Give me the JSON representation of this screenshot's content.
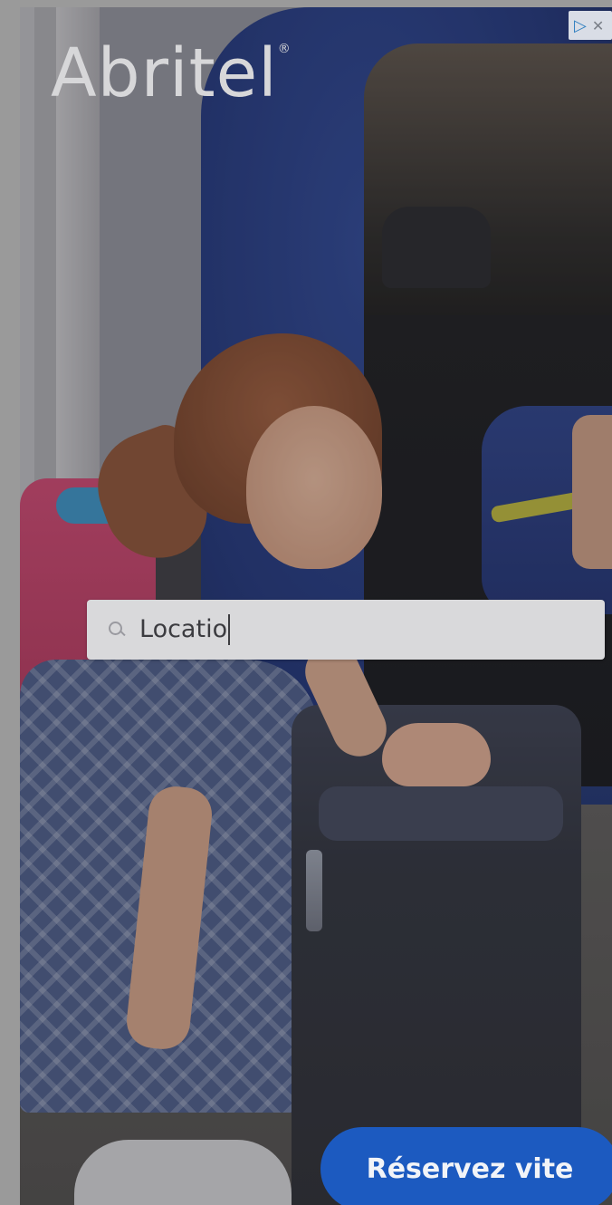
{
  "ad": {
    "brand": "Abritel",
    "brand_mark": "®",
    "search": {
      "typed_text": "Locatio"
    },
    "cta_label": "Réservez vite",
    "adchoices_icon": "adchoices-icon",
    "close_icon": "close-icon",
    "colors": {
      "cta_background": "#1c5ac0",
      "search_background": "#d9d9db",
      "logo_text": "#d7d7d9"
    }
  }
}
